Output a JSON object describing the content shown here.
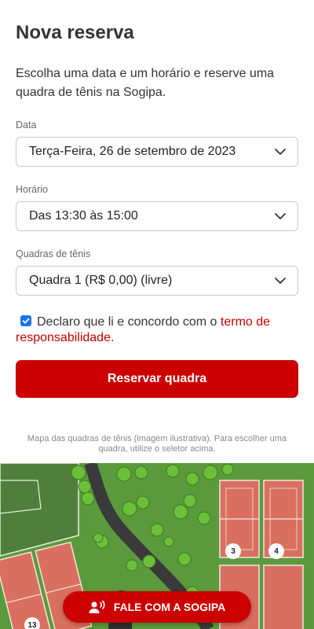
{
  "form": {
    "title": "Nova reserva",
    "intro": "Escolha uma data e um horário e reserve uma quadra de tênis na Sogipa.",
    "date_label": "Data",
    "date_value": "Terça-Feira, 26 de setembro de 2023",
    "time_label": "Horário",
    "time_value": "Das 13:30 às 15:00",
    "court_label": "Quadras de tênis",
    "court_value": "Quadra 1 (R$ 0,00) (livre)",
    "consent_text": "Declaro que li e concordo com o",
    "consent_link": "termo de responsabilidade",
    "consent_end": ".",
    "consent_checked": true,
    "submit_label": "Reservar quadra"
  },
  "map": {
    "caption": "Mapa das quadras de tênis (imagem ilustrativa). Para escolher uma quadra, utilize o seletor acima.",
    "court_numbers": [
      "3",
      "4",
      "13"
    ]
  },
  "contact": {
    "label": "FALE COM A SOGIPA"
  },
  "colors": {
    "accent": "#cc0000",
    "checkbox": "#1a73e8",
    "grass": "#5b9a3c",
    "court": "#d9705f"
  }
}
